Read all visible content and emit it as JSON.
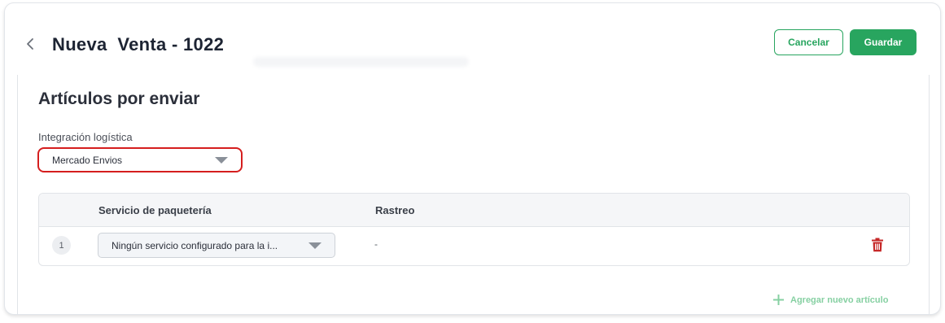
{
  "header": {
    "title": "Nueva  Venta - 1022",
    "cancel_label": "Cancelar",
    "save_label": "Guardar"
  },
  "section": {
    "title": "Artículos por enviar",
    "integration_label": "Integración logística",
    "integration_value": "Mercado Envios"
  },
  "table": {
    "columns": [
      "Servicio de paquetería",
      "Rastreo"
    ],
    "rows": [
      {
        "number": "1",
        "service": "Ningún servicio configurado para la i...",
        "tracking": "-"
      }
    ]
  },
  "add_item_label": "Agregar nuevo artículo",
  "colors": {
    "accent": "#28a55f",
    "highlight": "#d51e1e",
    "delete": "#c62828",
    "add_link": "#86d0a2"
  }
}
